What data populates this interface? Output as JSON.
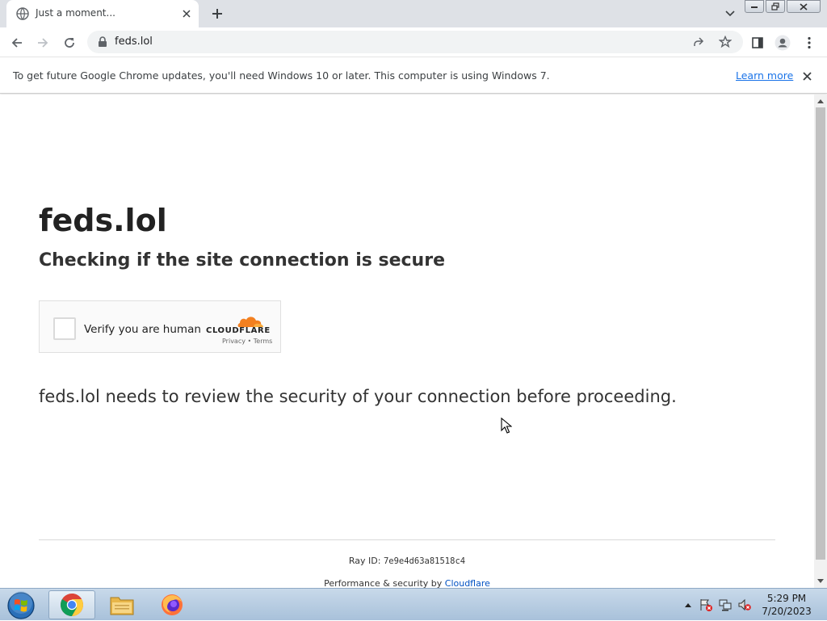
{
  "browser": {
    "tab_title": "Just a moment...",
    "url": "feds.lol",
    "infobar_message": "To get future Google Chrome updates, you'll need Windows 10 or later. This computer is using Windows 7.",
    "infobar_link": "Learn more"
  },
  "page": {
    "site_title": "feds.lol",
    "subtitle": "Checking if the site connection is secure",
    "challenge": {
      "label": "Verify you are human",
      "brand": "CLOUDFLARE",
      "links": "Privacy • Terms"
    },
    "review_message": "feds.lol needs to review the security of your connection before proceeding.",
    "footer": {
      "ray_label": "Ray ID:",
      "ray_id": "7e9e4d63a81518c4",
      "perf_prefix": "Performance & security by",
      "perf_link": "Cloudflare"
    }
  },
  "taskbar": {
    "apps": [
      "chrome-icon",
      "file-explorer-icon",
      "firefox-icon"
    ],
    "time": "5:29 PM",
    "date": "7/20/2023"
  },
  "colors": {
    "cloudflare_orange": "#f38020",
    "link_blue": "#1a73e8",
    "footer_link": "#0051c3"
  }
}
